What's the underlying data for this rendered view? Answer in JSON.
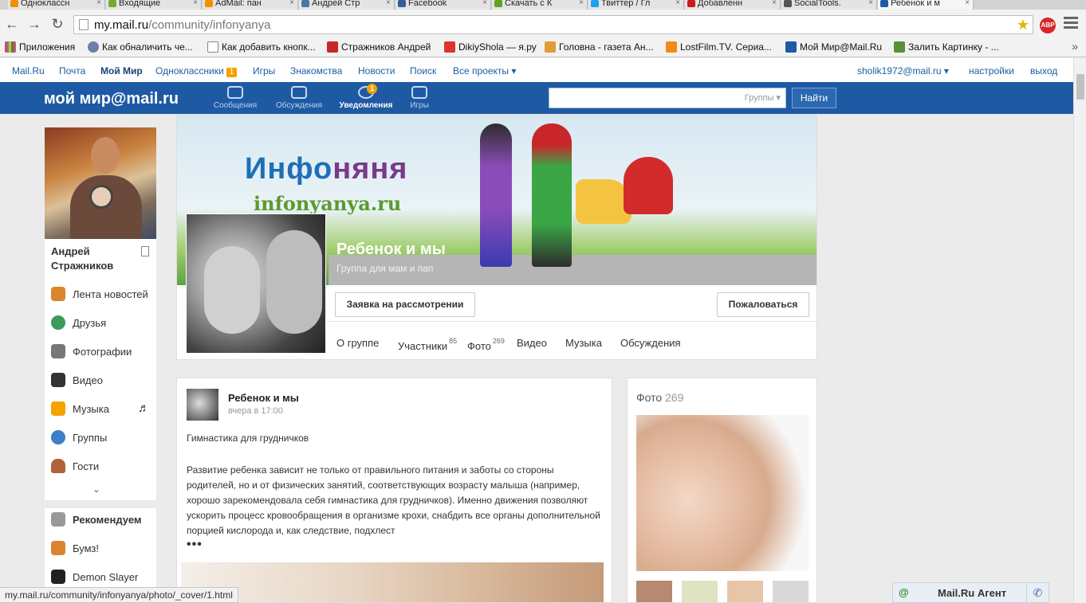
{
  "browser": {
    "tabs": [
      {
        "label": "Одноклассн",
        "color": "#f09000"
      },
      {
        "label": "Входящие",
        "color": "#78a832"
      },
      {
        "label": "AdMail: пан",
        "color": "#f09000"
      },
      {
        "label": "Андрей Стр",
        "color": "#4a76a8"
      },
      {
        "label": "Facebook",
        "color": "#3b5998"
      },
      {
        "label": "Скачать с К",
        "color": "#63a11e"
      },
      {
        "label": "Твиттер / Гл",
        "color": "#1da1f2"
      },
      {
        "label": "Добавленн",
        "color": "#cc181e"
      },
      {
        "label": "SocialTools.",
        "color": "#555555"
      },
      {
        "label": "Ребенок и м",
        "color": "#1e5aa3"
      }
    ],
    "url_host": "my.mail.ru",
    "url_path": "/community/infonyanya",
    "bookmarks": [
      {
        "label": "Приложения",
        "color": "#d94a38"
      },
      {
        "label": "Как обналичить че...",
        "color": "#6b7fa8"
      },
      {
        "label": "Как добавить кнопк...",
        "color": "#ffffff"
      },
      {
        "label": "Стражников Андрей",
        "color": "#c62828"
      },
      {
        "label": "DikiyShola — я.ру",
        "color": "#d8362e"
      },
      {
        "label": "Головна - газета Ан...",
        "color": "#e39a38"
      },
      {
        "label": "LostFilm.TV. Сериа...",
        "color": "#f28a18"
      },
      {
        "label": "Мой Мир@Mail.Ru",
        "color": "#1e5aa3"
      },
      {
        "label": "Залить Картинку - ...",
        "color": "#5b8f3c"
      }
    ],
    "bookmarks_more": "»",
    "status_url": "my.mail.ru/community/infonyanya/photo/_cover/1.html"
  },
  "portal": {
    "links": [
      "Mail.Ru",
      "Почта",
      "Мой Мир",
      "Одноклассники",
      "Игры",
      "Знакомства",
      "Новости",
      "Поиск",
      "Все проекты ▾"
    ],
    "ok_badge": "1",
    "user_email": "sholik1972@mail.ru ▾",
    "settings": "настройки",
    "logout": "выход"
  },
  "header": {
    "logo": "мой мир@mail.ru",
    "nav": [
      "Сообщения",
      "Обсуждения",
      "Уведомления",
      "Игры"
    ],
    "notifications_count": "1",
    "search_placeholder": "",
    "search_scope": "Группы ▾",
    "search_button": "Найти"
  },
  "sidebar": {
    "user_name": "Андрей Стражников",
    "items": [
      {
        "label": "Лента новостей",
        "icon": "home-icon",
        "color": "#d9852b"
      },
      {
        "label": "Друзья",
        "icon": "friends-icon",
        "color": "#3d9a5a"
      },
      {
        "label": "Фотографии",
        "icon": "camera-icon",
        "color": "#777777"
      },
      {
        "label": "Видео",
        "icon": "film-icon",
        "color": "#333333"
      },
      {
        "label": "Музыка",
        "icon": "music-note-icon",
        "color": "#f2a300"
      },
      {
        "label": "Группы",
        "icon": "groups-icon",
        "color": "#3d7fc4"
      },
      {
        "label": "Гости",
        "icon": "hat-icon",
        "color": "#b0623a"
      }
    ],
    "expand_icon": "⌄",
    "apps": [
      {
        "label": "Рекомендуем",
        "icon": "gamepad-icon",
        "color": "#999999"
      },
      {
        "label": "Бумз!",
        "icon": "boomz-icon",
        "color": "#d9852b"
      },
      {
        "label": "Demon Slayer",
        "icon": "skull-icon",
        "color": "#222222"
      }
    ]
  },
  "group": {
    "cover_brand_a": "Инфо",
    "cover_brand_b": "няня",
    "cover_site": "infonyanya.ru",
    "name": "Ребенок и мы",
    "subtitle": "Группа для мам и пап",
    "request_button": "Заявка на рассмотрении",
    "complain_button": "Пожаловаться",
    "tabs": {
      "about": "О группе",
      "members": "Участники",
      "members_count": "85",
      "photos": "Фото",
      "photos_count": "269",
      "video": "Видео",
      "music": "Музыка",
      "discussions": "Обсуждения"
    }
  },
  "post": {
    "author": "Ребенок и мы",
    "time": "вчера в 17:00",
    "title": "Гимнастика для грудничков",
    "text": "Развитие ребенка зависит не только от правильного питания и заботы со стороны родителей, но и от физических занятий, соответствующих возрасту малыша (например, хорошо зарекомендовала себя гимнастика для грудничков). Именно движения позволяют ускорить процесс кровообращения в организме крохи, снабдить все органы дополнительной порцией кислорода и, как следствие, подхлест",
    "more": "•••"
  },
  "photos_widget": {
    "title": "Фото",
    "count": "269"
  },
  "agent": {
    "label": "Mail.Ru Агент",
    "icon": "@"
  }
}
